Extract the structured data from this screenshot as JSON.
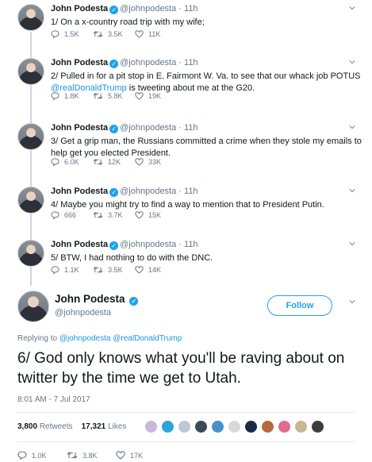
{
  "author": {
    "name": "John Podesta",
    "handle": "@johnpodesta",
    "verified_icon": "verified-badge-icon"
  },
  "thread": [
    {
      "time": "11h",
      "text_parts": [
        {
          "text": "1/ On a x-country road trip with my wife;"
        }
      ],
      "replies": "1.5K",
      "retweets": "3.5K",
      "likes": "11K"
    },
    {
      "time": "11h",
      "text_parts": [
        {
          "text": "2/ Pulled in for a pit stop in E. Fairmont W. Va. to see that our whack job POTUS "
        },
        {
          "text": "@realDonaldTrump",
          "mention": true
        },
        {
          "text": " is tweeting about me at the G20."
        }
      ],
      "replies": "1.8K",
      "retweets": "5.8K",
      "likes": "19K"
    },
    {
      "time": "11h",
      "text_parts": [
        {
          "text": "3/ Get a grip man, the Russians committed a crime when they stole my emails to help get you elected President."
        }
      ],
      "replies": "6.0K",
      "retweets": "12K",
      "likes": "33K"
    },
    {
      "time": "11h",
      "text_parts": [
        {
          "text": "4/ Maybe you might try to find a way to mention that to President Putin."
        }
      ],
      "replies": "666",
      "retweets": "3.7K",
      "likes": "15K"
    },
    {
      "time": "11h",
      "text_parts": [
        {
          "text": "5/ BTW, I had nothing to do with the DNC."
        }
      ],
      "replies": "1.1K",
      "retweets": "3.5K",
      "likes": "14K"
    }
  ],
  "main": {
    "follow_label": "Follow",
    "replying_label": "Replying to",
    "replying_to": [
      "@johnpodesta",
      "@realDonaldTrump"
    ],
    "text": "6/ God only knows what you'll be raving about on twitter by the time we get to Utah.",
    "timestamp": "8:01 AM - 7 Jul 2017",
    "retweets_count": "3,800",
    "retweets_label": "Retweets",
    "likes_count": "17,321",
    "likes_label": "Likes",
    "liker_colors": [
      "#c9b8d8",
      "#2aa6d6",
      "#b9c7d6",
      "#3a4a5c",
      "#4a90c8",
      "#d8d8d8",
      "#1c2a44",
      "#b8683f",
      "#e06b8b",
      "#c7b68e",
      "#3d3d3d"
    ],
    "replies": "1.0K",
    "retweets": "3.8K",
    "likes": "17K"
  },
  "colors": {
    "accent": "#1da1f2",
    "mention": "#1b95e0",
    "muted": "#657786",
    "line": "#ccd6dd"
  }
}
